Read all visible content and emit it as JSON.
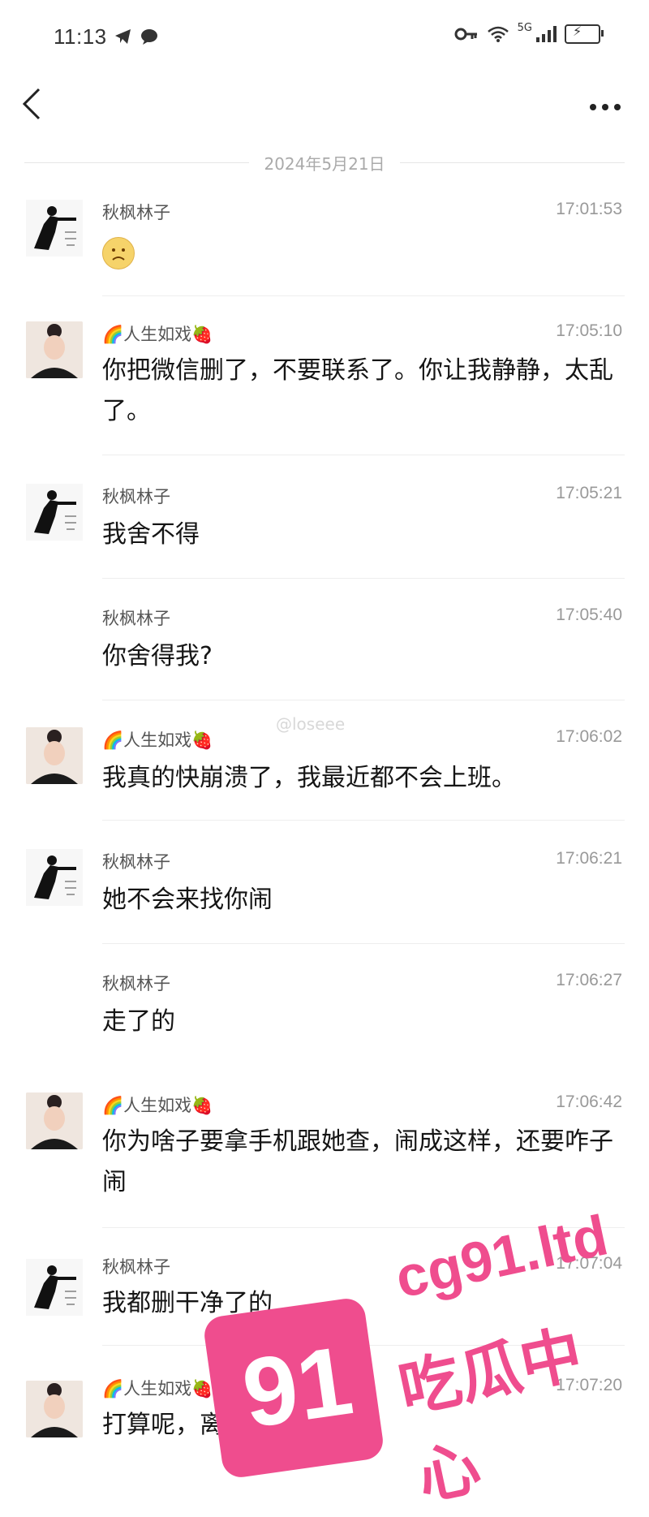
{
  "status_bar": {
    "time": "11:13",
    "network": "5G"
  },
  "header": {
    "back_icon": "chevron-left-icon",
    "more_icon": "more-dots-icon"
  },
  "date_divider": "2024年5月21日",
  "messages": [
    {
      "sender": "秋枫林子",
      "time": "17:01:53",
      "text": "",
      "emoji": "sad-face-icon"
    },
    {
      "sender": "🌈人生如戏🍓",
      "time": "17:05:10",
      "text": "你把微信删了，不要联系了。你让我静静，太乱了。"
    },
    {
      "sender": "秋枫林子",
      "time": "17:05:21",
      "text": "我舍不得"
    },
    {
      "sender": "秋枫林子",
      "time": "17:05:40",
      "text": "你舍得我?"
    },
    {
      "sender": "🌈人生如戏🍓",
      "time": "17:06:02",
      "text": "我真的快崩溃了，我最近都不会上班。"
    },
    {
      "sender": "秋枫林子",
      "time": "17:06:21",
      "text": "她不会来找你闹"
    },
    {
      "sender": "秋枫林子",
      "time": "17:06:27",
      "text": "走了的"
    },
    {
      "sender": "🌈人生如戏🍓",
      "time": "17:06:42",
      "text": "你为啥子要拿手机跟她查，闹成这样，还要咋子闹"
    },
    {
      "sender": "秋枫林子",
      "time": "17:07:04",
      "text": "我都删干净了的"
    },
    {
      "sender": "🌈人生如戏🍓",
      "time": "17:07:20",
      "text": "打算呢，离婚"
    }
  ],
  "watermarks": {
    "weibo": "@loseee",
    "brand_number": "91",
    "brand_domain": "cg91.ltd",
    "brand_cn": "吃瓜中心"
  }
}
